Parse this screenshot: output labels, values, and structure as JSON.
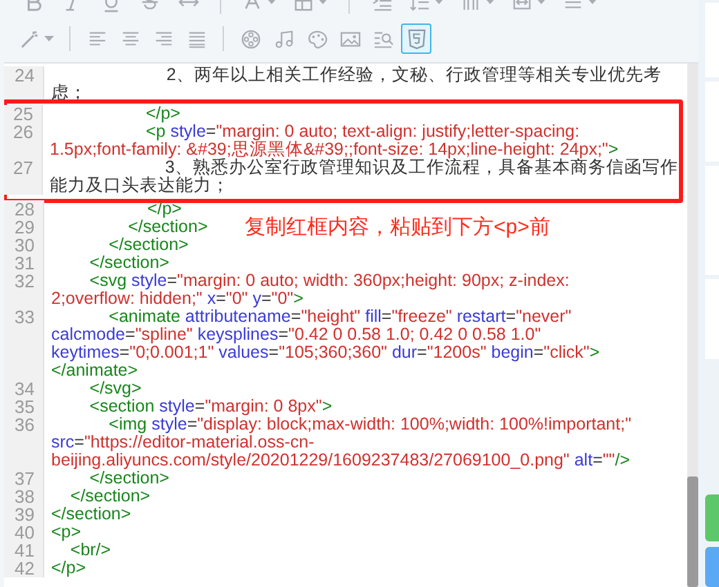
{
  "toolbar": {
    "rows": [
      [
        {
          "kind": "bold",
          "selected": false
        },
        {
          "kind": "italic",
          "selected": false
        },
        {
          "kind": "underline",
          "selected": false
        },
        {
          "kind": "strike",
          "selected": false
        },
        {
          "kind": "hr",
          "selected": false
        },
        {
          "kind": "sep"
        },
        {
          "kind": "font-color",
          "selected": false
        },
        {
          "kind": "table",
          "selected": false
        },
        {
          "kind": "sep"
        },
        {
          "kind": "indent",
          "selected": false
        },
        {
          "kind": "line-height",
          "selected": false
        },
        {
          "kind": "columns",
          "selected": false
        },
        {
          "kind": "width",
          "selected": false
        },
        {
          "kind": "more",
          "selected": false
        }
      ],
      [
        {
          "kind": "wand",
          "selected": false
        },
        {
          "kind": "sep"
        },
        {
          "kind": "align-left",
          "selected": false
        },
        {
          "kind": "align-center",
          "selected": false
        },
        {
          "kind": "align-right",
          "selected": false
        },
        {
          "kind": "align-justify",
          "selected": false
        },
        {
          "kind": "sep"
        },
        {
          "kind": "video",
          "selected": false
        },
        {
          "kind": "music",
          "selected": false
        },
        {
          "kind": "palette",
          "selected": false
        },
        {
          "kind": "image",
          "selected": false
        },
        {
          "kind": "find",
          "selected": false
        },
        {
          "kind": "html",
          "selected": true
        }
      ]
    ]
  },
  "editor": {
    "lines": [
      {
        "number": "24",
        "highlighted": false,
        "tokens": [
          {
            "kind": "text",
            "text": "                        2、两年以上相关工作经验，文秘、行政管理等相关专业优先考"
          },
          {
            "kind": "text",
            "text": "虑；",
            "wrap": true
          }
        ]
      },
      {
        "number": "25",
        "highlighted": true,
        "tokens": [
          {
            "kind": "tag",
            "text": "                    </p>"
          }
        ]
      },
      {
        "number": "26",
        "highlighted": true,
        "tokens": [
          {
            "kind": "tag",
            "text": "                    <p"
          },
          {
            "kind": "attr",
            "text": " style"
          },
          {
            "kind": "punct",
            "text": "="
          },
          {
            "kind": "value",
            "text": "\"margin: 0 auto; text-align: justify;letter-spacing:"
          },
          {
            "kind": "value",
            "text": "1.5px;font-family: &#39;思源黑体&#39;;font-size: 14px;line-height: 24px;\"",
            "wrap": true
          },
          {
            "kind": "tag",
            "text": ">"
          }
        ]
      },
      {
        "number": "27",
        "highlighted": true,
        "tokens": [
          {
            "kind": "text",
            "text": "                        3、熟悉办公室行政管理知识及工作流程，具备基本商务信函写作"
          },
          {
            "kind": "text",
            "text": "能力及口头表达能力；",
            "wrap": true
          }
        ]
      },
      {
        "number": "28",
        "highlighted": false,
        "tokens": [
          {
            "kind": "tag",
            "text": "                    </p>"
          }
        ]
      },
      {
        "number": "29",
        "highlighted": false,
        "tokens": [
          {
            "kind": "tag",
            "text": "                </section>"
          }
        ]
      },
      {
        "number": "30",
        "highlighted": false,
        "tokens": [
          {
            "kind": "tag",
            "text": "            </section>"
          }
        ]
      },
      {
        "number": "31",
        "highlighted": false,
        "tokens": [
          {
            "kind": "tag",
            "text": "        </section>"
          }
        ]
      },
      {
        "number": "32",
        "highlighted": false,
        "tokens": [
          {
            "kind": "tag",
            "text": "        <svg"
          },
          {
            "kind": "attr",
            "text": " style"
          },
          {
            "kind": "punct",
            "text": "="
          },
          {
            "kind": "value",
            "text": "\"margin: 0 auto; width: 360px;height: 90px; z-index:"
          },
          {
            "kind": "value",
            "text": "2;overflow: hidden;\"",
            "wrap": true
          },
          {
            "kind": "attr",
            "text": " x"
          },
          {
            "kind": "punct",
            "text": "="
          },
          {
            "kind": "value",
            "text": "\"0\""
          },
          {
            "kind": "attr",
            "text": " y"
          },
          {
            "kind": "punct",
            "text": "="
          },
          {
            "kind": "value",
            "text": "\"0\""
          },
          {
            "kind": "tag",
            "text": ">"
          }
        ]
      },
      {
        "number": "33",
        "highlighted": false,
        "tokens": [
          {
            "kind": "tag",
            "text": "            <animate"
          },
          {
            "kind": "attr",
            "text": " attributename"
          },
          {
            "kind": "punct",
            "text": "="
          },
          {
            "kind": "value",
            "text": "\"height\""
          },
          {
            "kind": "attr",
            "text": " fill"
          },
          {
            "kind": "punct",
            "text": "="
          },
          {
            "kind": "value",
            "text": "\"freeze\""
          },
          {
            "kind": "attr",
            "text": " restart"
          },
          {
            "kind": "punct",
            "text": "="
          },
          {
            "kind": "value",
            "text": "\"never\""
          },
          {
            "kind": "attr",
            "text": "calcmode",
            "wrap": true
          },
          {
            "kind": "punct",
            "text": "="
          },
          {
            "kind": "value",
            "text": "\"spline\""
          },
          {
            "kind": "attr",
            "text": " keysplines"
          },
          {
            "kind": "punct",
            "text": "="
          },
          {
            "kind": "value",
            "text": "\"0.42 0 0.58 1.0; 0.42 0 0.58 1.0\""
          },
          {
            "kind": "attr",
            "text": "keytimes",
            "wrap": true
          },
          {
            "kind": "punct",
            "text": "="
          },
          {
            "kind": "value",
            "text": "\"0;0.001;1\""
          },
          {
            "kind": "attr",
            "text": " values"
          },
          {
            "kind": "punct",
            "text": "="
          },
          {
            "kind": "value",
            "text": "\"105;360;360\""
          },
          {
            "kind": "attr",
            "text": " dur"
          },
          {
            "kind": "punct",
            "text": "="
          },
          {
            "kind": "value",
            "text": "\"1200s\""
          },
          {
            "kind": "attr",
            "text": " begin"
          },
          {
            "kind": "punct",
            "text": "="
          },
          {
            "kind": "value",
            "text": "\"click\""
          },
          {
            "kind": "tag",
            "text": ">"
          },
          {
            "kind": "tag",
            "text": "</animate>",
            "wrap": true
          }
        ]
      },
      {
        "number": "34",
        "highlighted": false,
        "tokens": [
          {
            "kind": "tag",
            "text": "        </svg>"
          }
        ]
      },
      {
        "number": "35",
        "highlighted": false,
        "tokens": [
          {
            "kind": "tag",
            "text": "        <section"
          },
          {
            "kind": "attr",
            "text": " style"
          },
          {
            "kind": "punct",
            "text": "="
          },
          {
            "kind": "value",
            "text": "\"margin: 0 8px\""
          },
          {
            "kind": "tag",
            "text": ">"
          }
        ]
      },
      {
        "number": "36",
        "highlighted": false,
        "tokens": [
          {
            "kind": "tag",
            "text": "            <img"
          },
          {
            "kind": "attr",
            "text": " style"
          },
          {
            "kind": "punct",
            "text": "="
          },
          {
            "kind": "value",
            "text": "\"display: block;max-width: 100%;width: 100%!important;\""
          },
          {
            "kind": "attr",
            "text": "src",
            "wrap": true
          },
          {
            "kind": "punct",
            "text": "="
          },
          {
            "kind": "value",
            "text": "\"https://editor-material.oss-cn-"
          },
          {
            "kind": "value",
            "text": "beijing.aliyuncs.com/style/20201229/1609237483/27069100_0.png\"",
            "wrap": true
          },
          {
            "kind": "attr",
            "text": " alt"
          },
          {
            "kind": "punct",
            "text": "="
          },
          {
            "kind": "value",
            "text": "\"\""
          },
          {
            "kind": "tag",
            "text": "/>"
          }
        ]
      },
      {
        "number": "37",
        "highlighted": false,
        "tokens": [
          {
            "kind": "tag",
            "text": "        </section>"
          }
        ]
      },
      {
        "number": "38",
        "highlighted": false,
        "tokens": [
          {
            "kind": "tag",
            "text": "    </section>"
          }
        ]
      },
      {
        "number": "39",
        "highlighted": false,
        "tokens": [
          {
            "kind": "tag",
            "text": "</section>"
          }
        ]
      },
      {
        "number": "40",
        "highlighted": false,
        "tokens": [
          {
            "kind": "tag",
            "text": "<p>"
          }
        ]
      },
      {
        "number": "41",
        "highlighted": false,
        "tokens": [
          {
            "kind": "tag",
            "text": "    <br/>"
          }
        ]
      },
      {
        "number": "42",
        "highlighted": false,
        "tokens": [
          {
            "kind": "tag",
            "text": "</p>"
          }
        ]
      }
    ]
  },
  "annotation": "复制红框内容，粘贴到下方<p>前"
}
